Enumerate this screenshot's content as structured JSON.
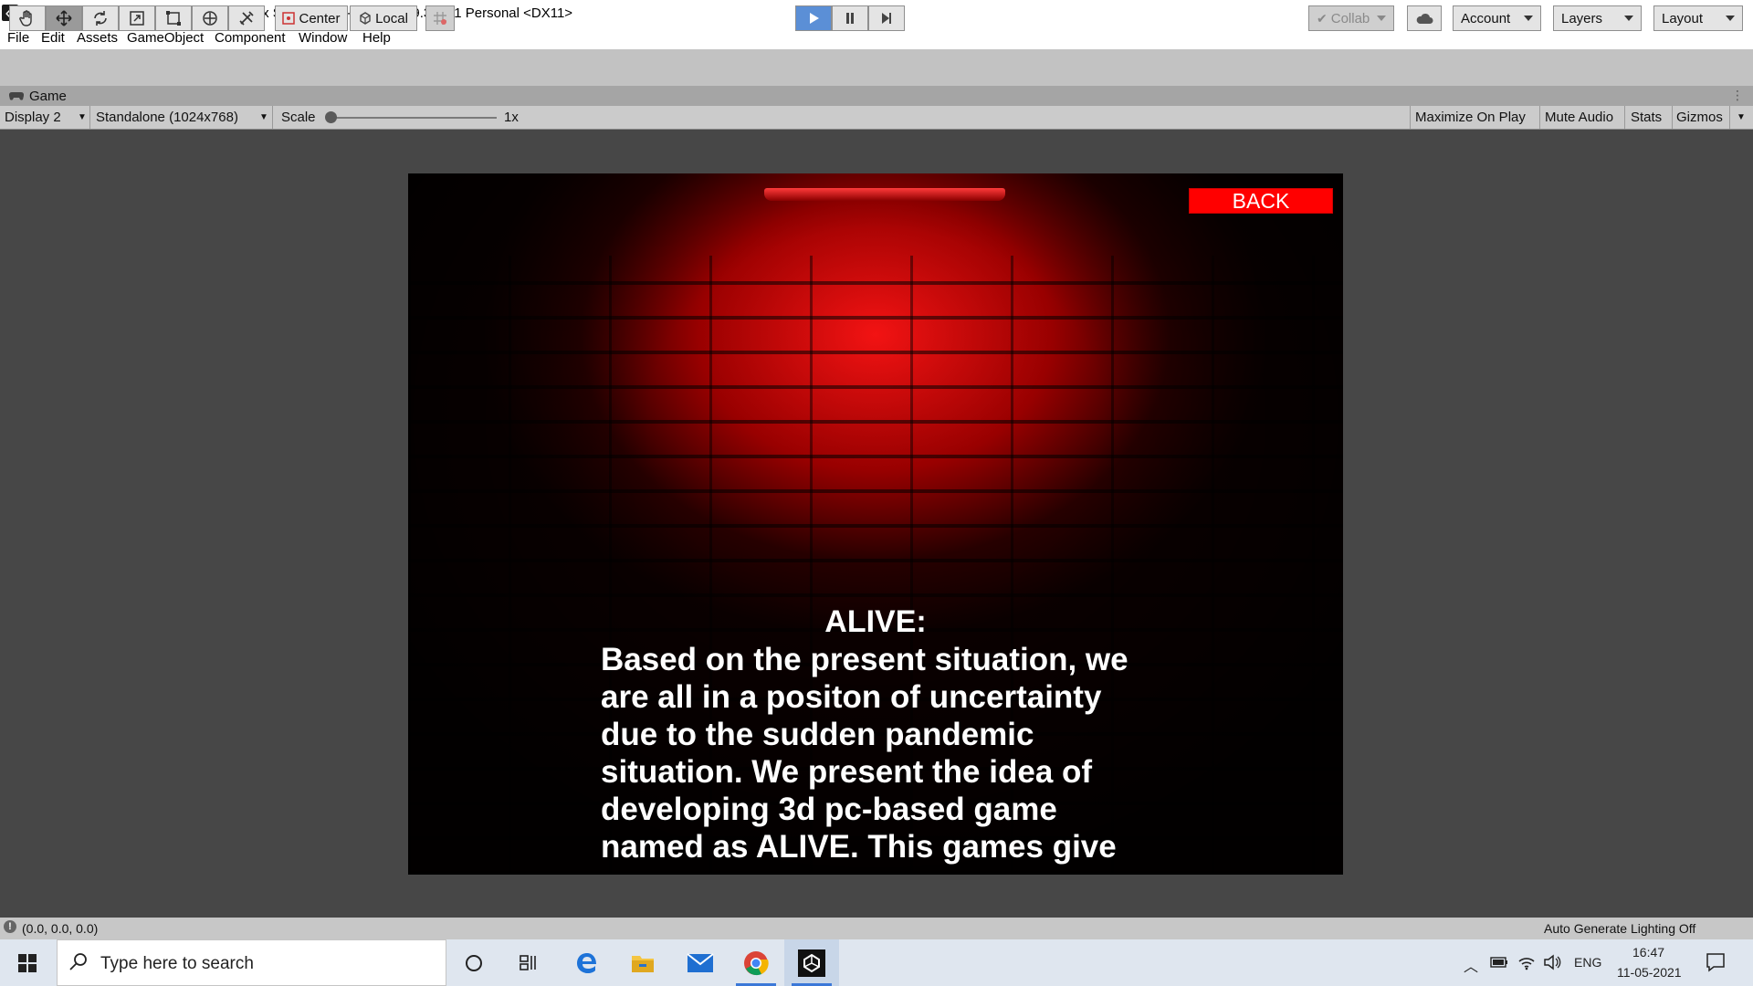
{
  "window": {
    "title": "aliveproject - aboutus - PC, Mac & Linux Standalone - Unity 2019.3.14f1 Personal <DX11>",
    "minimize": "—",
    "restore": "❐",
    "close": "✕"
  },
  "menu": [
    "File",
    "Edit",
    "Assets",
    "GameObject",
    "Component",
    "Window",
    "Help"
  ],
  "toolbar": {
    "tools": [
      "hand-icon",
      "move-icon",
      "rotate-icon",
      "scale-icon",
      "rect-icon",
      "transform-icon",
      "custom-tool-icon"
    ],
    "pivot_label": "Center",
    "space_label": "Local",
    "collab_label": "Collab",
    "account_label": "Account",
    "layers_label": "Layers",
    "layout_label": "Layout",
    "play_state": "playing"
  },
  "game_tab": {
    "label": "Game"
  },
  "game_toolbar": {
    "display": "Display 2",
    "resolution": "Standalone (1024x768)",
    "scale_label": "Scale",
    "scale_value": "1x",
    "scale_level": 0,
    "maximize_label": "Maximize On Play",
    "mute_label": "Mute Audio",
    "stats_label": "Stats",
    "gizmos_label": "Gizmos"
  },
  "game_screen": {
    "back_label": "BACK",
    "heading": "ALIVE:",
    "body": "Based on the present situation, we\nare all in a positon of uncertainty\ndue to the sudden pandemic\nsituation. We present the idea of\ndeveloping 3d pc-based game\nnamed as ALIVE. This games give",
    "accent_color": "#ff0000"
  },
  "status_bar": {
    "message": "(0.0, 0.0, 0.0)",
    "lighting": "Auto Generate Lighting Off"
  },
  "taskbar": {
    "search_placeholder": "Type here to search",
    "tray_language": "ENG",
    "time": "16:47",
    "date": "11-05-2021"
  }
}
